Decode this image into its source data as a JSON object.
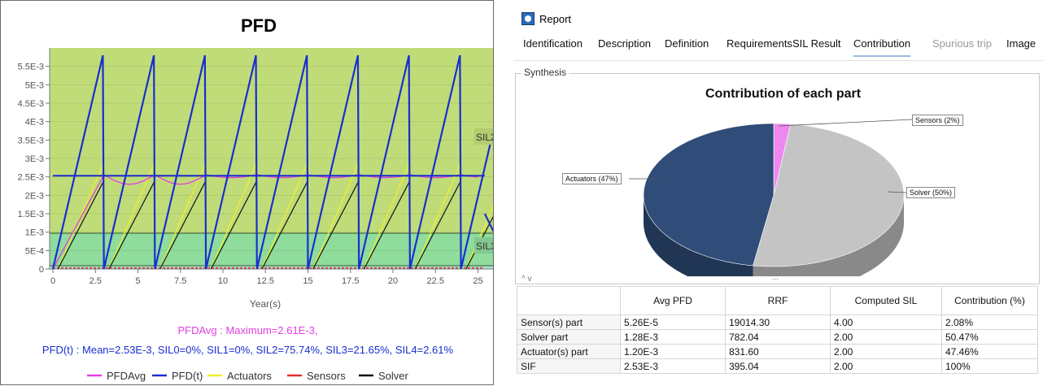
{
  "left_chart": {
    "title": "PFD",
    "xlabel": "Year(s)",
    "y_ticks": [
      "0",
      "5E-4",
      "1E-3",
      "1.5E-3",
      "2E-3",
      "2.5E-3",
      "3E-3",
      "3.5E-3",
      "4E-3",
      "4.5E-3",
      "5E-3",
      "5.5E-3"
    ],
    "x_ticks": [
      "0",
      "2.5",
      "5",
      "7.5",
      "10",
      "12.5",
      "15",
      "17.5",
      "20",
      "22.5",
      "25"
    ],
    "zone_labels": [
      "SIL2",
      "SIL3"
    ],
    "pfdavg_text": "PFDAvg : Maximum=2.61E-3,",
    "pfdt_text": "PFD(t) : Mean=2.53E-3,  SIL0=0%,  SIL1=0%,  SIL2=75.74%,  SIL3=21.65%,  SIL4=2.61%",
    "legend": [
      "PFDAvg",
      "PFD(t)",
      "Actuators",
      "Sensors",
      "Solver"
    ],
    "colors": {
      "pfdavg": "#e23ee0",
      "pfdt": "#1a2ed0",
      "actuators": "#f0ee2a",
      "sensors": "#e03030",
      "solver": "#111111",
      "sil2_zone": "#c0dc78",
      "sil3_zone": "#8fdc9c"
    }
  },
  "chart_data": {
    "type": "line",
    "title": "PFD",
    "xlabel": "Year(s)",
    "ylabel": "",
    "xlim": [
      0,
      26
    ],
    "ylim": [
      0,
      0.006
    ],
    "series": [
      {
        "name": "PFD(t)",
        "proof_test_interval": 3,
        "peak": 0.0058,
        "mean": 0.00253
      },
      {
        "name": "PFDAvg",
        "max": 0.00261,
        "min": 0.00232
      },
      {
        "name": "Actuators"
      },
      {
        "name": "Sensors"
      },
      {
        "name": "Solver"
      }
    ],
    "zones": [
      {
        "label": "SIL2",
        "from": 0.001,
        "to": 0.01
      },
      {
        "label": "SIL3",
        "from": 0.0001,
        "to": 0.001
      }
    ]
  },
  "report": {
    "title": "Report",
    "tabs": [
      "Identification",
      "Description",
      "Definition",
      "Requirements",
      "SIL Result",
      "Contribution",
      "Spurious trip",
      "Image"
    ],
    "active_tab": "Contribution",
    "group_label": "Synthesis",
    "pie": {
      "title": "Contribution of each part",
      "slices": [
        {
          "label": "Sensors (2%)",
          "value": 2.08,
          "color": "#ee88ee"
        },
        {
          "label": "Solver (50%)",
          "value": 50.47,
          "color": "#c4c4c4"
        },
        {
          "label": "Actuators (47%)",
          "value": 47.46,
          "color": "#2f4d78"
        }
      ]
    },
    "splitter": {
      "arrows": "^ v",
      "grip": "..."
    },
    "table": {
      "headers": [
        "",
        "Avg PFD",
        "RRF",
        "Computed SIL",
        "Contribution (%)"
      ],
      "rows": [
        [
          "Sensor(s) part",
          "5.26E-5",
          "19014.30",
          "4.00",
          "2.08%"
        ],
        [
          "Solver part",
          "1.28E-3",
          "782.04",
          "2.00",
          "50.47%"
        ],
        [
          "Actuator(s) part",
          "1.20E-3",
          "831.60",
          "2.00",
          "47.46%"
        ],
        [
          "SIF",
          "2.53E-3",
          "395.04",
          "2.00",
          "100%"
        ]
      ]
    }
  }
}
